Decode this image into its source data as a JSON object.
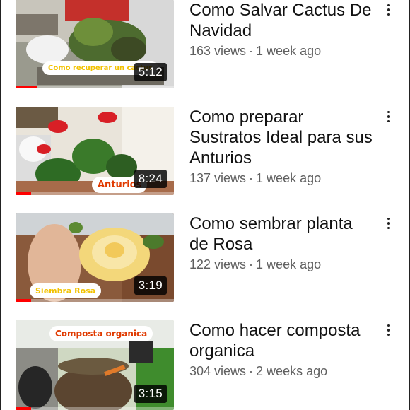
{
  "videos": [
    {
      "title": "Como Salvar Cactus De Navidad",
      "views": "163 views",
      "age": "1 week ago",
      "duration": "5:12",
      "thumbnail_caption": "Como recuperar un cactus",
      "watched_fraction": 0.14
    },
    {
      "title": "Como preparar Sustratos Ideal para sus Anturios",
      "views": "137 views",
      "age": "1 week ago",
      "duration": "8:24",
      "thumbnail_caption": "Anturios",
      "watched_fraction": 0.1
    },
    {
      "title": "Como sembrar planta de Rosa",
      "views": "122 views",
      "age": "1 week ago",
      "duration": "3:19",
      "thumbnail_caption": "Siembra Rosa",
      "watched_fraction": 0.1
    },
    {
      "title": "Como hacer composta organica",
      "views": "304 views",
      "age": "2 weeks ago",
      "duration": "3:15",
      "thumbnail_caption": "Composta organica",
      "watched_fraction": 0.1
    }
  ],
  "colors": {
    "progress": "#ff0000",
    "title": "#111111",
    "meta": "#606060"
  },
  "icons": {
    "more": "more-vert-icon"
  }
}
